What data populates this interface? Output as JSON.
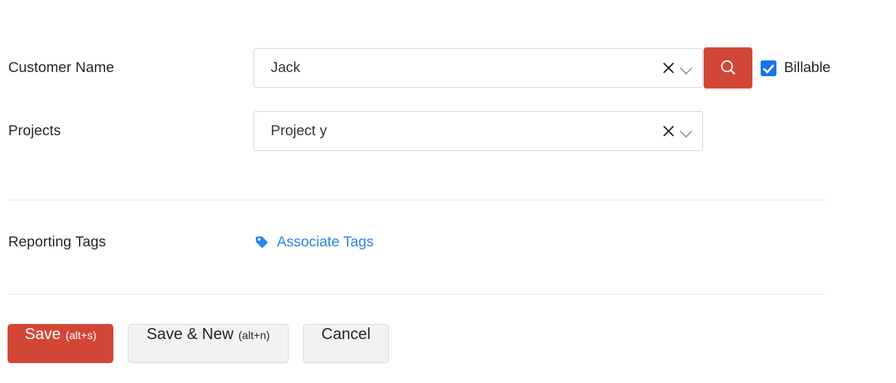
{
  "form": {
    "customer": {
      "label": "Customer Name",
      "value": "Jack",
      "clear_icon": "close-x-icon",
      "dropdown_icon": "chevron-down-icon",
      "search_button": {
        "icon": "search-icon",
        "color": "#d24636"
      },
      "billable": {
        "label": "Billable",
        "checked": true,
        "color": "#1a73f0"
      }
    },
    "projects": {
      "label": "Projects",
      "value": "Project y",
      "clear_icon": "close-x-icon",
      "dropdown_icon": "chevron-down-icon"
    },
    "reporting_tags": {
      "label": "Reporting Tags",
      "link_text": "Associate Tags",
      "link_icon": "tag-icon",
      "link_color": "#2a84e8"
    }
  },
  "actions": {
    "save": {
      "label": "Save",
      "shortcut": "(alt+s)"
    },
    "save_and_new": {
      "label": "Save & New",
      "shortcut": "(alt+n)"
    },
    "cancel": {
      "label": "Cancel"
    }
  },
  "colors": {
    "accent_red": "#d24636",
    "link_blue": "#2a84e8",
    "checkbox_blue": "#1a73f0",
    "border_gray": "#ccd2d9",
    "divider_gray": "#e4e6e8"
  }
}
